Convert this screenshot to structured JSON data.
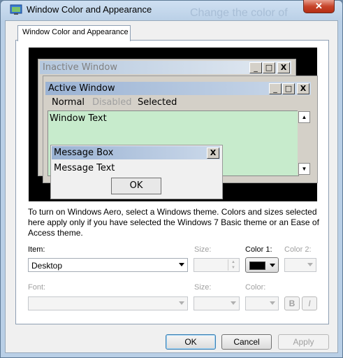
{
  "window": {
    "title": "Window Color and Appearance",
    "background_text": "Change the color of"
  },
  "tabs": [
    {
      "label": "Window Color and Appearance"
    }
  ],
  "preview": {
    "inactive_title": "Inactive Window",
    "active_title": "Active Window",
    "menu": {
      "normal": "Normal",
      "disabled": "Disabled",
      "selected": "Selected"
    },
    "window_text": "Window Text",
    "message_box": {
      "title": "Message Box",
      "text": "Message Text",
      "ok": "OK"
    },
    "caption_buttons": {
      "minimize": "_",
      "maximize": "□",
      "close": "X"
    },
    "colors": {
      "window_bg": "#c7ebcc",
      "active_caption": "#9ab2d3",
      "inactive_caption": "#b5c8de"
    }
  },
  "description": "To turn on Windows Aero, select a Windows theme.  Colors and sizes selected here apply only if you have selected the Windows 7 Basic theme or an Ease of Access theme.",
  "form": {
    "item_label": "Item:",
    "item_value": "Desktop",
    "size_label": "Size:",
    "size_value": "",
    "color1_label": "Color 1:",
    "color1_value": "#000000",
    "color2_label": "Color 2:",
    "font_label": "Font:",
    "font_value": "",
    "font_size_label": "Size:",
    "font_color_label": "Color:",
    "bold_label": "B",
    "italic_label": "I"
  },
  "buttons": {
    "ok": "OK",
    "cancel": "Cancel",
    "apply": "Apply"
  }
}
